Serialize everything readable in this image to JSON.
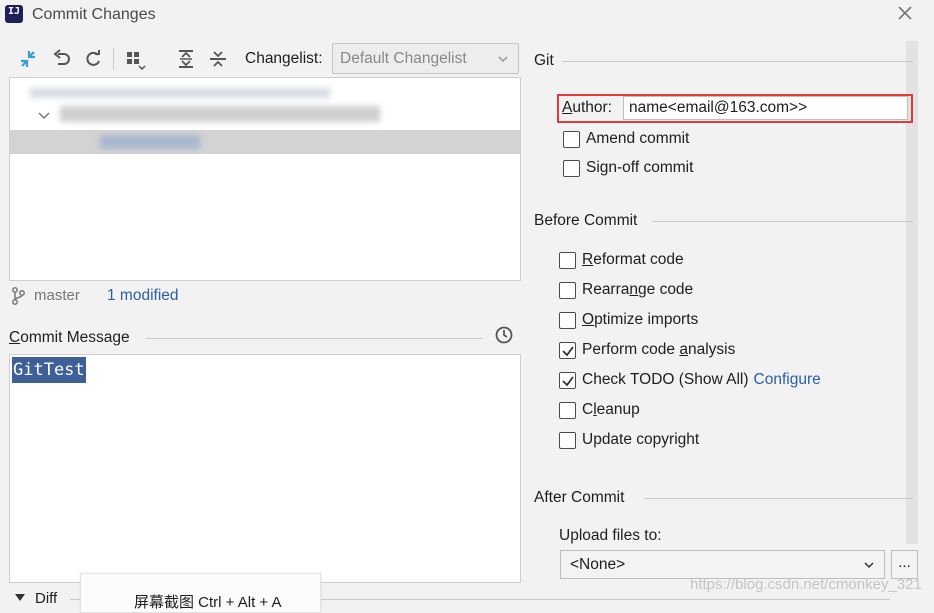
{
  "window": {
    "title": "Commit Changes",
    "app_icon_text": "IJ"
  },
  "toolbar": {
    "changelist_label": "Changelist:",
    "changelist_value": "Default Changelist"
  },
  "status": {
    "branch": "master",
    "modified": "1 modified"
  },
  "commit_message": {
    "label": "Commit Message",
    "text": "GitTest"
  },
  "git": {
    "section": "Git",
    "author_label": "Author:",
    "author_value": "name<email@163.com>>",
    "amend": "Amend commit",
    "signoff": "Sign-off commit"
  },
  "before_commit": {
    "section": "Before Commit",
    "options": [
      {
        "label": "Reformat code",
        "checked": false
      },
      {
        "label": "Rearrange code",
        "checked": false
      },
      {
        "label": "Optimize imports",
        "checked": false
      },
      {
        "label": "Perform code analysis",
        "checked": true
      },
      {
        "label": "Check TODO (Show All)",
        "checked": true
      },
      {
        "label": "Cleanup",
        "checked": false
      },
      {
        "label": "Update copyright",
        "checked": false
      }
    ],
    "configure_link": "Configure"
  },
  "after_commit": {
    "section": "After Commit",
    "upload_label": "Upload files to:",
    "upload_value": "<None>",
    "browse": "..."
  },
  "diff": {
    "label": "Diff"
  },
  "overlay": {
    "screenshot_tooltip": "屏幕截图 Ctrl + Alt + A",
    "watermark": "https://blog.csdn.net/cmonkey_321"
  },
  "colors": {
    "link": "#2b5ea6",
    "highlight_box": "#e03a3a",
    "selection": "#3d6098",
    "toolbar_accent": "#389fd6"
  }
}
